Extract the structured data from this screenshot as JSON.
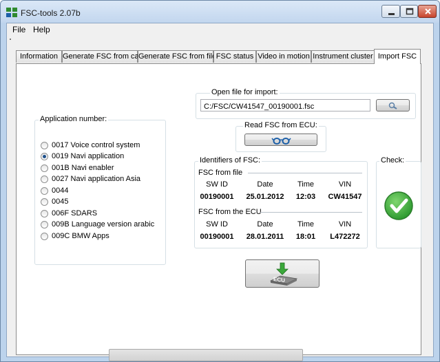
{
  "window": {
    "title": "FSC-tools 2.07b",
    "controls": [
      "minimize-icon",
      "maximize-icon",
      "close-icon"
    ]
  },
  "menu": [
    {
      "label": "File"
    },
    {
      "label": "Help"
    }
  ],
  "tabs": [
    {
      "label": "Information",
      "active": false
    },
    {
      "label": "Generate FSC from car",
      "active": false
    },
    {
      "label": "Generate FSC from file",
      "active": false
    },
    {
      "label": "FSC status",
      "active": false
    },
    {
      "label": "Video in motion",
      "active": false
    },
    {
      "label": "Instrument cluster",
      "active": false
    },
    {
      "label": "Import FSC",
      "active": true
    }
  ],
  "application_group": {
    "label": "Application number:",
    "options": [
      {
        "label": "0017 Voice control system",
        "selected": false
      },
      {
        "label": "0019 Navi application",
        "selected": true
      },
      {
        "label": "001B Navi enabler",
        "selected": false
      },
      {
        "label": "0027 Navi application Asia",
        "selected": false
      },
      {
        "label": "0044",
        "selected": false
      },
      {
        "label": "0045",
        "selected": false
      },
      {
        "label": "006F SDARS",
        "selected": false
      },
      {
        "label": "009B Language version arabic",
        "selected": false
      },
      {
        "label": "009C BMW Apps",
        "selected": false
      }
    ]
  },
  "open_file": {
    "label": "Open file for import:",
    "value": "C:/FSC/CW41547_00190001.fsc",
    "browse_icon": "magnifier-icon"
  },
  "read_ecu": {
    "label": "Read FSC from ECU:",
    "icon": "glasses-icon"
  },
  "identifiers": {
    "label": "Identifiers of FSC:",
    "columns": [
      "SW ID",
      "Date",
      "Time",
      "VIN"
    ],
    "from_file": {
      "label": "FSC from file",
      "sw_id": "00190001",
      "date": "25.01.2012",
      "time": "12:03",
      "vin": "CW41547"
    },
    "from_ecu": {
      "label": "FSC from the ECU",
      "sw_id": "00190001",
      "date": "28.01.2011",
      "time": "18:01",
      "vin": "L472272"
    }
  },
  "check": {
    "label": "Check:",
    "icon": "checkmark-icon",
    "color": "#3aa83a"
  },
  "write_button": {
    "icon_text": "ECU",
    "icon": "write-to-ecu-icon"
  },
  "progress": {
    "value": 0
  }
}
